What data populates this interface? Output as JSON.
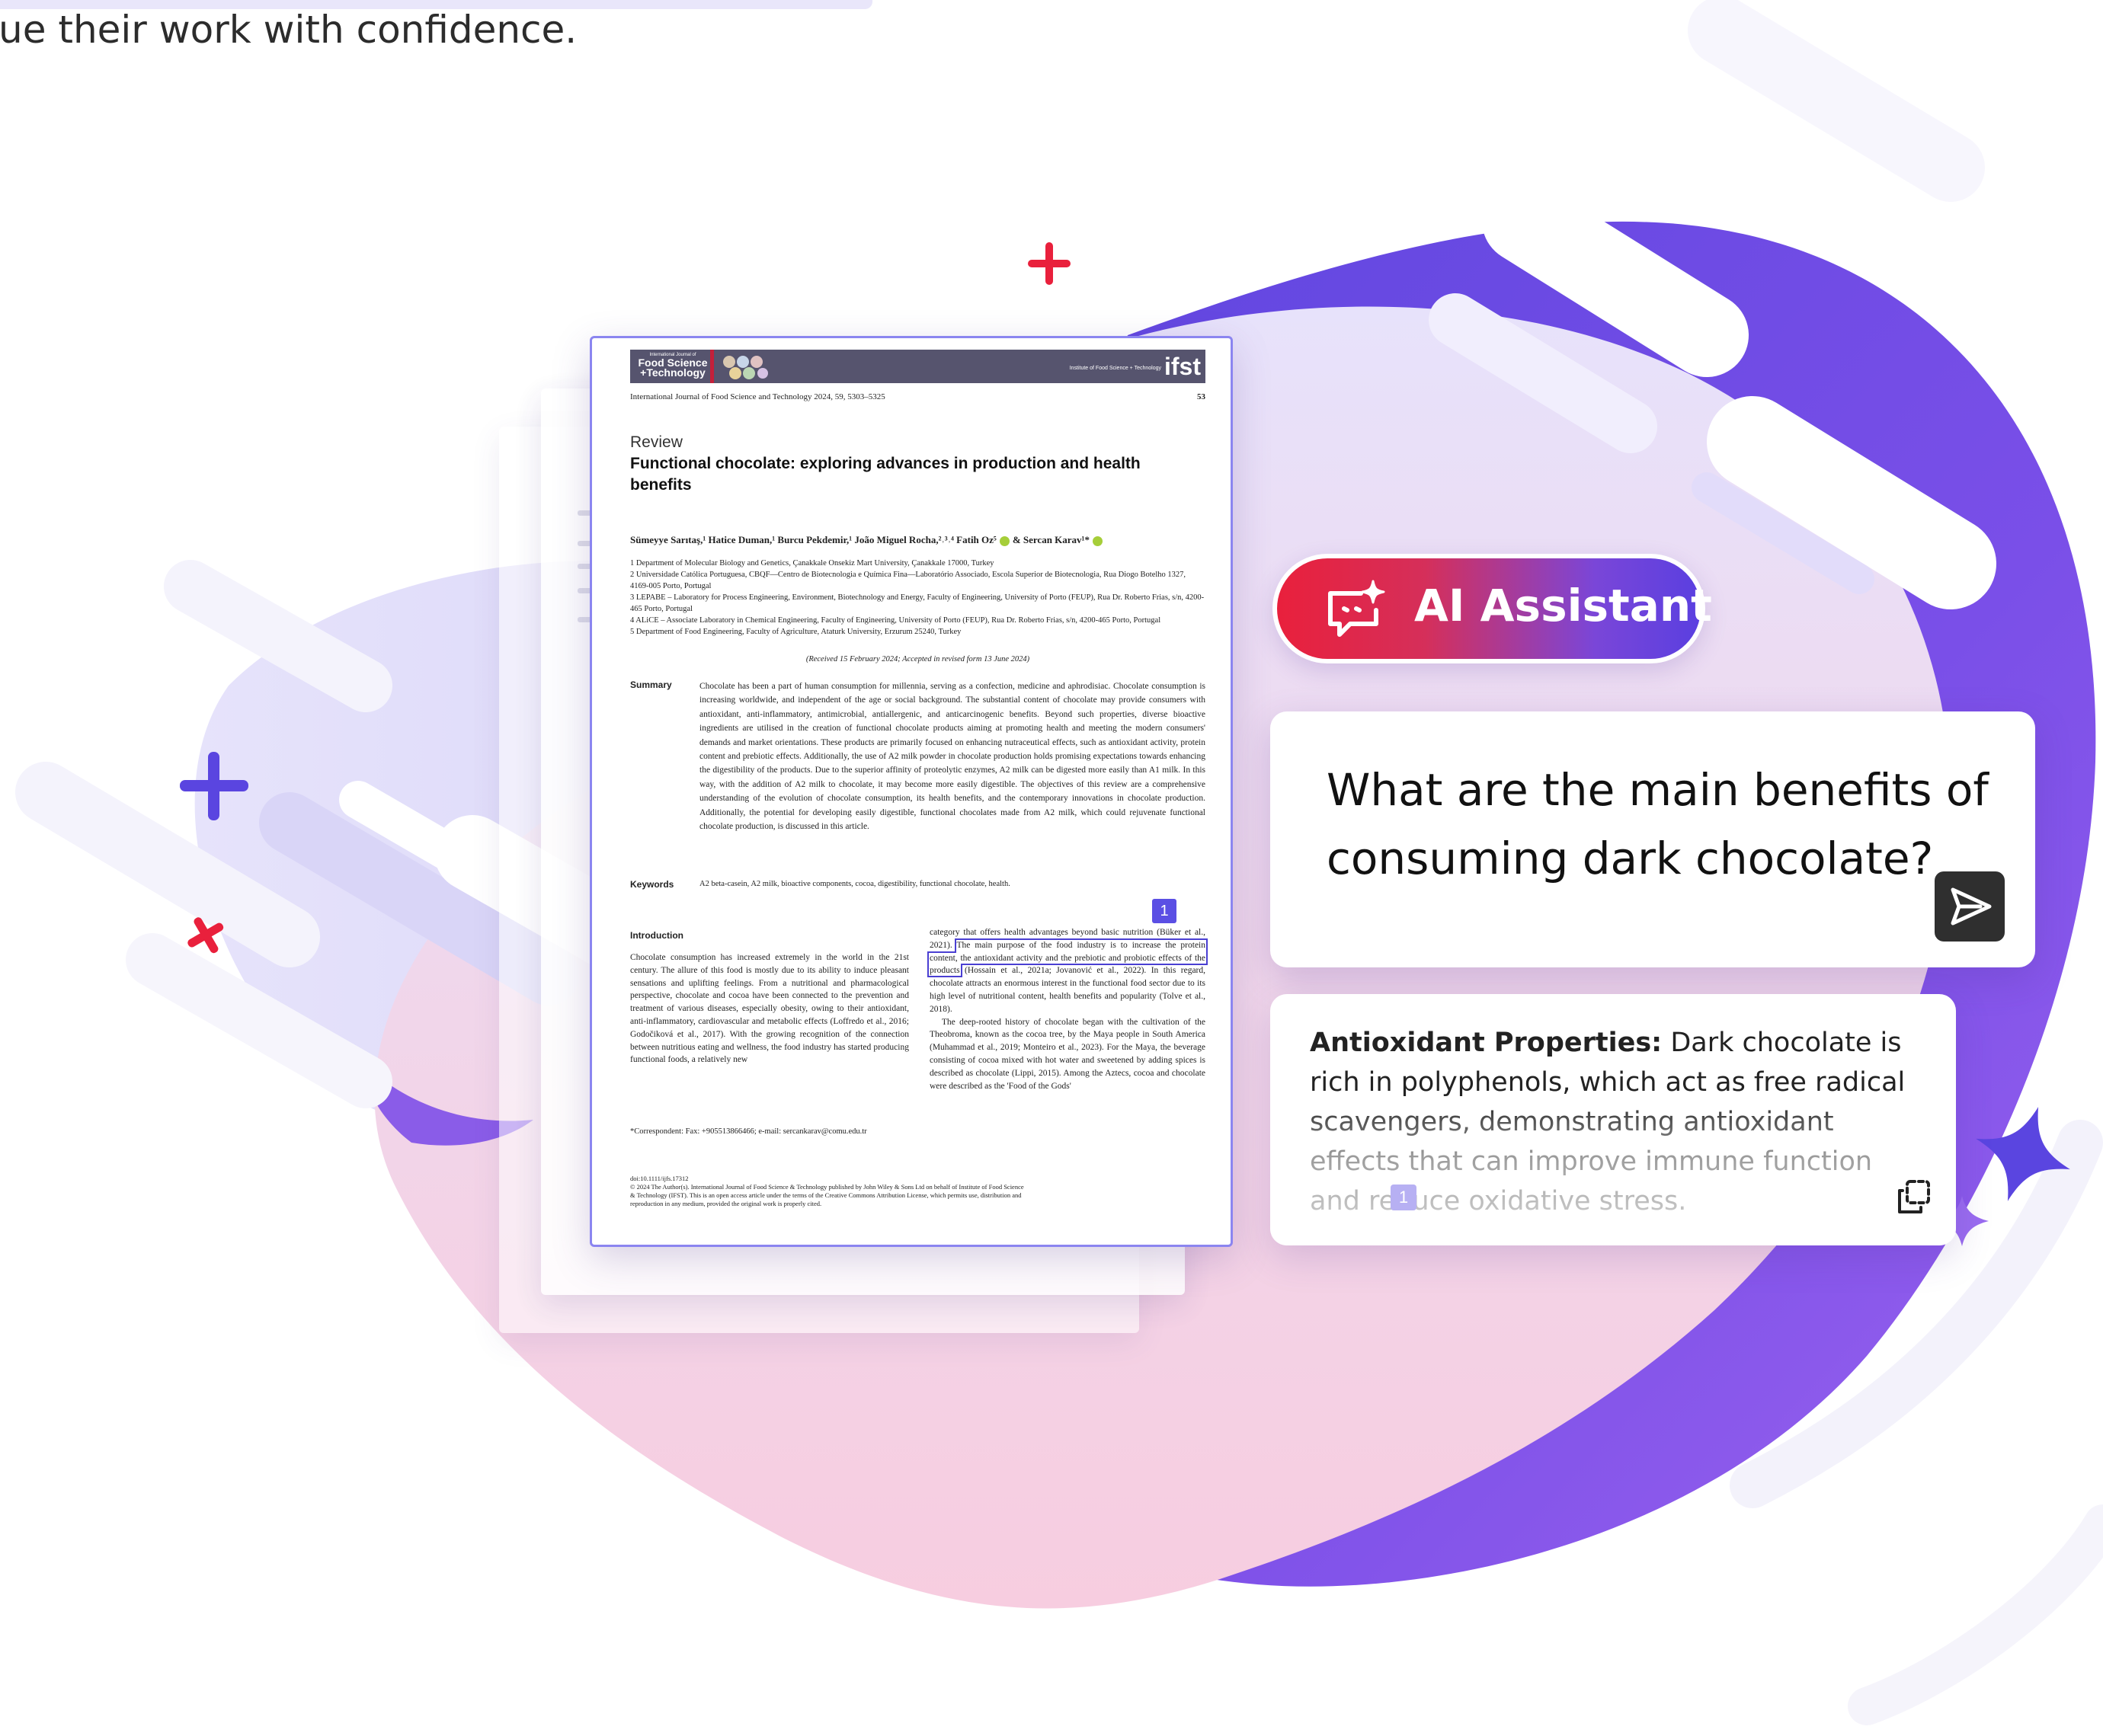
{
  "header": {
    "tagline": "ue their work with confidence."
  },
  "document": {
    "journal_logo_line1": "International Journal of",
    "journal_logo_line2": "Food Science",
    "journal_logo_line3": "+Technology",
    "publisher_logo": "ifst",
    "publisher_sub": "Institute of Food Science + Technology",
    "journal_ref": "International Journal of Food Science and Technology 2024, 59, 5303–5325",
    "page_number": "53",
    "article_type": "Review",
    "title": "Functional chocolate: exploring advances in production and health benefits",
    "authors": "Sümeyye Sarıtaş,¹ Hatice Duman,¹ Burcu Pekdemir,¹ João Miguel Rocha,²˒³˒⁴ Fatih Oz⁵",
    "authors_last": "& Sercan Karav¹*",
    "affiliations": [
      "1 Department of Molecular Biology and Genetics, Çanakkale Onsekiz Mart University, Çanakkale 17000, Turkey",
      "2 Universidade Católica Portuguesa, CBQF—Centro de Biotecnologia e Química Fina—Laboratório Associado, Escola Superior de Biotecnologia, Rua Diogo Botelho 1327, 4169-005 Porto, Portugal",
      "3 LEPABE – Laboratory for Process Engineering, Environment, Biotechnology and Energy, Faculty of Engineering, University of Porto (FEUP), Rua Dr. Roberto Frias, s/n, 4200-465 Porto, Portugal",
      "4 ALiCE – Associate Laboratory in Chemical Engineering, Faculty of Engineering, University of Porto (FEUP), Rua Dr. Roberto Frias, s/n, 4200-465 Porto, Portugal",
      "5 Department of Food Engineering, Faculty of Agriculture, Ataturk University, Erzurum 25240, Turkey"
    ],
    "received": "(Received 15 February 2024; Accepted in revised form 13 June 2024)",
    "summary_label": "Summary",
    "summary_text": "Chocolate has been a part of human consumption for millennia, serving as a confection, medicine and aphrodisiac. Chocolate consumption is increasing worldwide, and independent of the age or social background. The substantial content of chocolate may provide consumers with antioxidant, anti-inflammatory, antimicrobial, antiallergenic, and anticarcinogenic benefits. Beyond such properties, diverse bioactive ingredients are utilised in the creation of functional chocolate products aiming at promoting health and meeting the modern consumers' demands and market orientations. These products are primarily focused on enhancing nutraceutical effects, such as antioxidant activity, protein content and prebiotic effects. Additionally, the use of A2 milk powder in chocolate production holds promising expectations towards enhancing the digestibility of the products. Due to the superior affinity of proteolytic enzymes, A2 milk can be digested more easily than A1 milk. In this way, with the addition of A2 milk to chocolate, it may become more easily digestible. The objectives of this review are a comprehensive understanding of the evolution of chocolate consumption, its health benefits, and the contemporary innovations in chocolate production. Additionally, the potential for developing easily digestible, functional chocolates made from A2 milk, which could rejuvenate functional chocolate production, is discussed in this article.",
    "keywords_label": "Keywords",
    "keywords_text": "A2 beta-casein, A2 milk, bioactive components, cocoa, digestibility, functional chocolate, health.",
    "intro_heading": "Introduction",
    "intro_col1": "Chocolate consumption has increased extremely in the world in the 21st century. The allure of this food is mostly due to its ability to induce pleasant sensations and uplifting feelings. From a nutritional and pharmacological perspective, chocolate and cocoa have been connected to the prevention and treatment of various diseases, especially obesity, owing to their antioxidant, anti-inflammatory, cardiovascular and metabolic effects (Loffredo et al., 2016; Godočiková et al., 2017). With the growing recognition of the connection between nutritious eating and wellness, the food industry has started producing functional foods, a relatively new",
    "intro_col2_a": "category that offers health advantages beyond basic nutrition (Büker et al., 2021).",
    "intro_col2_highlight": "The main purpose of the food industry is to increase the protein content, the antioxidant activity and the prebiotic and probiotic effects of the products",
    "intro_col2_b": "(Hossain et al., 2021a; Jovanović et al., 2022). In this regard, chocolate attracts an enormous interest in the functional food sector due to its high level of nutritional content, health benefits and popularity (Tolve et al., 2018).",
    "intro_col2_c": "The deep-rooted history of chocolate began with the cultivation of the Theobroma, known as the cocoa tree, by the Maya people in South America (Muhammad et al., 2019; Monteiro et al., 2023). For the Maya, the beverage consisting of cocoa mixed with hot water and sweetened by adding spices is described as chocolate (Lippi, 2015). Among the Aztecs, cocoa and chocolate were described as the 'Food of the Gods'",
    "reference_badge": "1",
    "correspondent": "*Correspondent: Fax: +905513866466; e-mail: sercankarav@comu.edu.tr",
    "doi": "doi:10.1111/ijfs.17312",
    "license": "© 2024 The Author(s). International Journal of Food Science & Technology published by John Wiley & Sons Ltd on behalf of Institute of Food Science & Technology (IFST). This is an open access article under the terms of the Creative Commons Attribution License, which permits use, distribution and reproduction in any medium, provided the original work is properly cited."
  },
  "assistant": {
    "label": "AI Assistant",
    "question": "What are the main benefits of consuming dark chocolate?",
    "answer_bold": "Antioxidant Properties:",
    "answer_text": "Dark chocolate is rich in polyphenols, which act as free radical scavengers, demonstrating antioxidant effects that can improve immune function and reduce oxidative stress.",
    "answer_ref": "1"
  },
  "colors": {
    "accent_purple": "#5b4fe4",
    "accent_red": "#e9203c",
    "blob_blue": "#5a3fe0",
    "blob_pink": "#f6c9dd"
  },
  "icons": [
    "ai-assistant-icon",
    "send-icon",
    "copy-icon",
    "plus-sparkle-icon",
    "star-sparkle-icon"
  ]
}
